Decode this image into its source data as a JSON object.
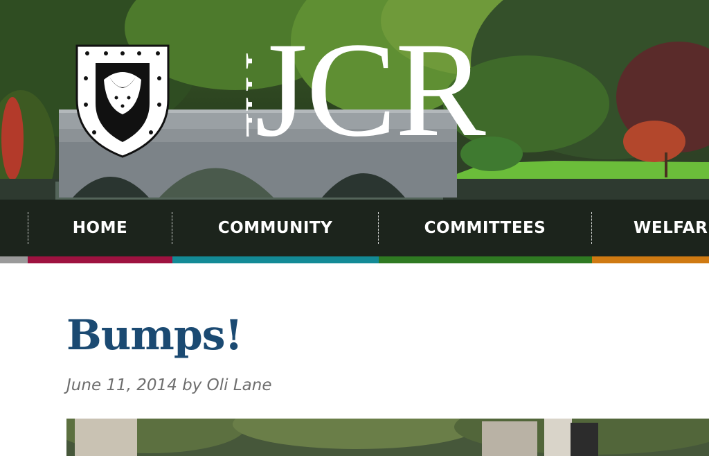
{
  "site": {
    "logo_text_the": "THE",
    "logo_text_jcr": "JCR"
  },
  "nav": {
    "items": [
      {
        "label": "HOME",
        "color": "#9e1240"
      },
      {
        "label": "COMMUNITY",
        "color": "#138a96"
      },
      {
        "label": "COMMITTEES",
        "color": "#2f7a22"
      },
      {
        "label": "WELFARE",
        "color": "#cf7a12"
      }
    ],
    "lead_color": "#9a9a9a"
  },
  "post": {
    "title": "Bumps!",
    "date": "June 11, 2014",
    "by": "by",
    "author": "Oli Lane"
  },
  "colors": {
    "title": "#1b4a72",
    "meta": "#6e6e6e"
  }
}
